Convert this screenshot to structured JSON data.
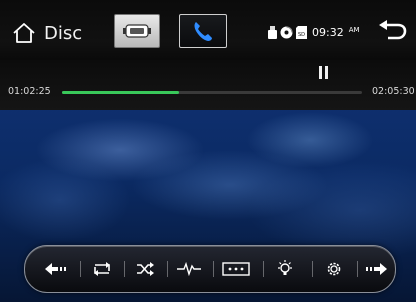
{
  "header": {
    "source_label": "Disc",
    "clock": {
      "time": "09:32",
      "period": "AM"
    },
    "status_icons": [
      "usb-icon",
      "disc-icon",
      "sd-card-icon"
    ],
    "buttons": [
      "home-icon",
      "media-source-button",
      "phone-button",
      "back-icon"
    ]
  },
  "player": {
    "elapsed": "01:02:25",
    "total": "02:05:30",
    "progress": 0.39,
    "state": "paused"
  },
  "controls": {
    "items": [
      "previous-icon",
      "repeat-icon",
      "shuffle-icon",
      "equalizer-icon",
      "menu-icon",
      "brightness-icon",
      "settings-icon",
      "next-icon"
    ]
  },
  "colors": {
    "progress_fill": "#39c85a",
    "track": "#3a3a3a",
    "phone_accent": "#2f8cff"
  }
}
